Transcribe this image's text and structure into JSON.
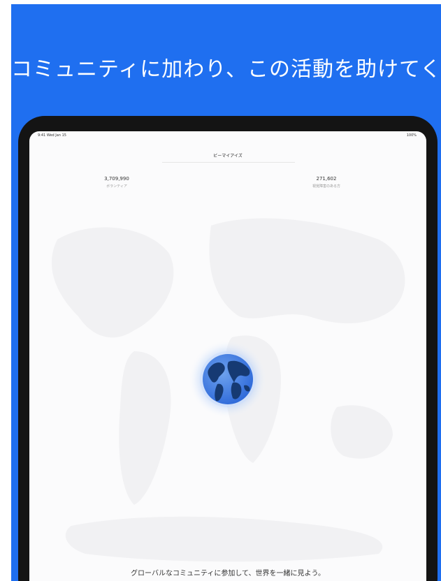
{
  "promo": {
    "headline": "コミュニティに加わり、この活動を助けてください",
    "background_color": "#1f6ff0"
  },
  "device": {
    "status_time": "9:41 Wed Jan 15",
    "status_battery": "100%",
    "nav_title": "ビーマイアイズ",
    "stats": {
      "left_value": "3,709,990",
      "left_label": "ボランティア",
      "right_value": "271,602",
      "right_label": "視覚障害のある方"
    },
    "globe_icon": "globe-icon",
    "caption": "グローバルなコミュニティに参加して、世界を一緒に見よう。"
  }
}
